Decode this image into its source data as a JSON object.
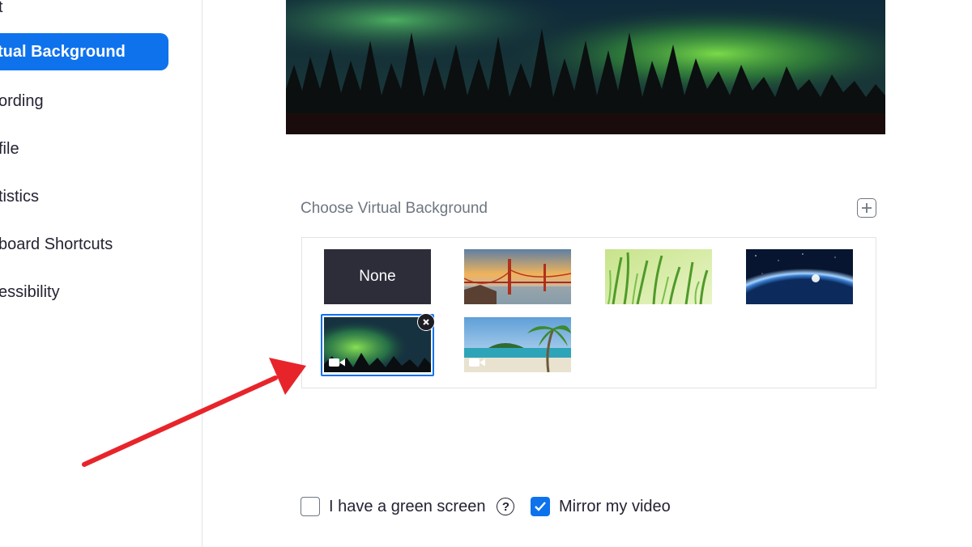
{
  "sidebar": {
    "items": [
      {
        "label": "t",
        "active": false
      },
      {
        "label": "tual Background",
        "active": true
      },
      {
        "label": "ording",
        "active": false
      },
      {
        "label": "file",
        "active": false
      },
      {
        "label": "tistics",
        "active": false
      },
      {
        "label": "board Shortcuts",
        "active": false
      },
      {
        "label": "essibility",
        "active": false
      }
    ]
  },
  "main": {
    "section_title": "Choose Virtual Background",
    "add_icon": "plus-icon",
    "backgrounds": [
      {
        "label": "None",
        "kind": "none"
      },
      {
        "kind": "image",
        "subject": "golden-gate-bridge"
      },
      {
        "kind": "image",
        "subject": "grass"
      },
      {
        "kind": "image",
        "subject": "earth-from-space"
      },
      {
        "kind": "video",
        "subject": "aurora",
        "selected": true
      },
      {
        "kind": "video",
        "subject": "beach"
      }
    ]
  },
  "options": {
    "green_screen": {
      "label": "I have a green screen",
      "checked": false
    },
    "mirror": {
      "label": "Mirror my video",
      "checked": true
    }
  },
  "colors": {
    "accent": "#0e72ed",
    "arrow": "#e8242b"
  }
}
